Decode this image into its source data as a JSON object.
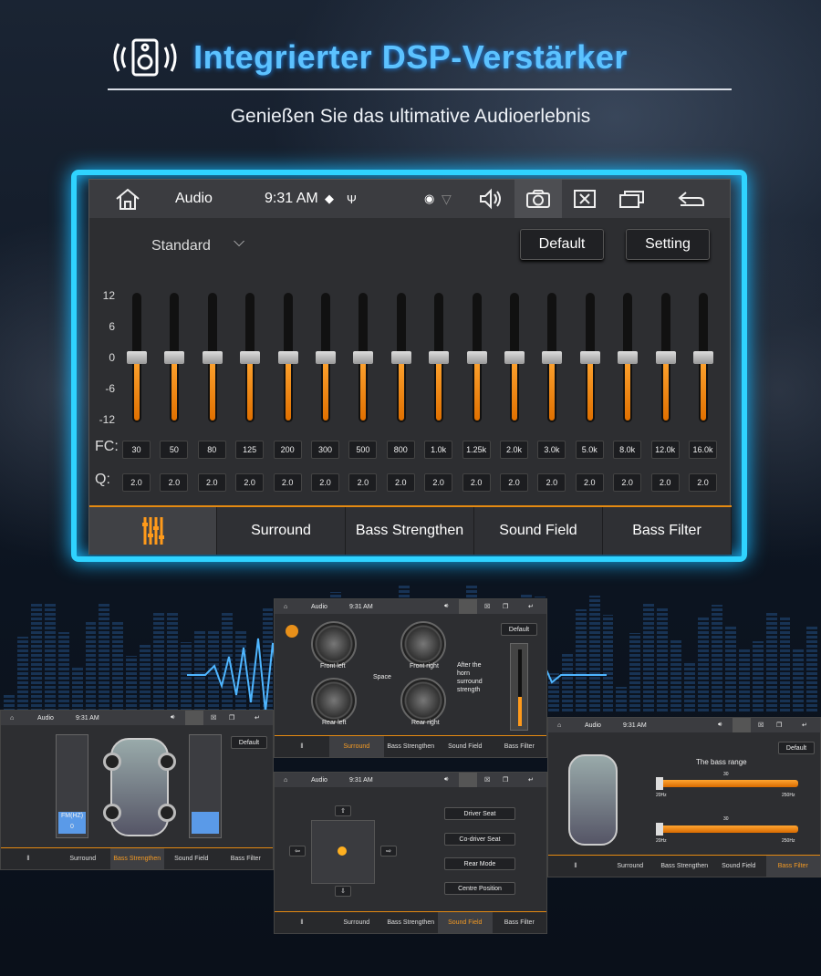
{
  "header": {
    "title": "Integrierter DSP-Verstärker",
    "subtitle": "Genießen Sie das ultimative Audioerlebnis"
  },
  "colors": {
    "accent": "#ff9a1a",
    "glow": "#2fd3ff",
    "title": "#5cc2ff"
  },
  "main": {
    "statusbar": {
      "app": "Audio",
      "time": "9:31 AM"
    },
    "preset": "Standard",
    "buttons": {
      "default": "Default",
      "setting": "Setting"
    },
    "y_labels": [
      "12",
      "6",
      "0",
      "-6",
      "-12"
    ],
    "fc_label": "FC:",
    "q_label": "Q:",
    "frequencies": [
      "30",
      "50",
      "80",
      "125",
      "200",
      "300",
      "500",
      "800",
      "1.0k",
      "1.25k",
      "2.0k",
      "3.0k",
      "5.0k",
      "8.0k",
      "12.0k",
      "16.0k"
    ],
    "q_values": [
      "2.0",
      "2.0",
      "2.0",
      "2.0",
      "2.0",
      "2.0",
      "2.0",
      "2.0",
      "2.0",
      "2.0",
      "2.0",
      "2.0",
      "2.0",
      "2.0",
      "2.0",
      "2.0"
    ],
    "gains_db": [
      0,
      0,
      0,
      0,
      0,
      0,
      0,
      0,
      0,
      0,
      0,
      0,
      0,
      0,
      0,
      0
    ],
    "tabs": [
      "Surround",
      "Bass Strengthen",
      "Sound Field",
      "Bass Filter"
    ]
  },
  "shots": {
    "surround": {
      "app": "Audio",
      "time": "9:31 AM",
      "default": "Default",
      "front_left": "Front left",
      "front_right": "Front right",
      "rear_left": "Rear left",
      "rear_right": "Rear right",
      "space": "Space",
      "note": "After the horn surround strength",
      "tabs": [
        "Surround",
        "Bass Strengthen",
        "Sound Field",
        "Bass Filter"
      ]
    },
    "bass": {
      "app": "Audio",
      "time": "9:31 AM",
      "default": "Default",
      "fm_label": "FM(HZ)",
      "fm_value": "0",
      "tabs": [
        "Surround",
        "Bass Strengthen",
        "Sound Field",
        "Bass Filter"
      ]
    },
    "field": {
      "app": "Audio",
      "time": "9:31 AM",
      "options": [
        "Driver Seat",
        "Co-driver Seat",
        "Rear Mode",
        "Centre Position"
      ],
      "tabs": [
        "Surround",
        "Bass Strengthen",
        "Sound Field",
        "Bass Filter"
      ]
    },
    "filter": {
      "app": "Audio",
      "time": "9:31 AM",
      "default": "Default",
      "title": "The bass range",
      "s1_value": "30",
      "s1_min": "20Hz",
      "s1_max": "250Hz",
      "s2_value": "30",
      "s2_min": "20Hz",
      "s2_max": "250Hz",
      "tabs": [
        "Surround",
        "Bass Strengthen",
        "Sound Field",
        "Bass Filter"
      ]
    }
  }
}
